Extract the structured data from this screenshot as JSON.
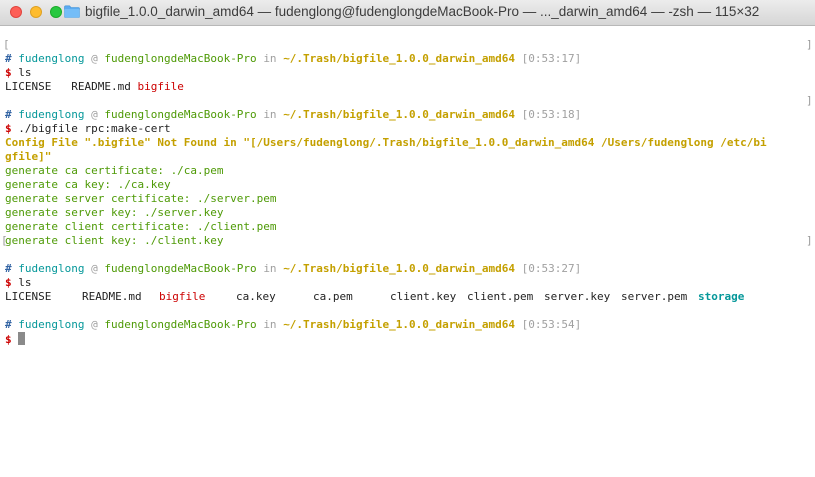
{
  "window": {
    "title": "bigfile_1.0.0_darwin_amd64 — fudenglong@fudenglongdeMacBook-Pro — ..._darwin_amd64 — -zsh — 115×32"
  },
  "prompt": {
    "hash": "#",
    "user": "fudenglong",
    "at": "@",
    "host": "fudenglongdeMacBook-Pro",
    "in": "in",
    "path": "~/.Trash/bigfile_1.0.0_darwin_amd64",
    "dollar": "$"
  },
  "blocks": [
    {
      "time": "[0:53:17]",
      "command": "ls",
      "ls": [
        "LICENSE",
        "README.md",
        "bigfile"
      ]
    },
    {
      "time": "[0:53:18]",
      "command": "./bigfile rpc:make-cert",
      "error_line1": "Config File \".bigfile\" Not Found in \"[/Users/fudenglong/.Trash/bigfile_1.0.0_darwin_amd64 /Users/fudenglong /etc/bi",
      "error_line2": "gfile]\"",
      "output": [
        "generate ca certificate: ./ca.pem",
        "generate ca key: ./ca.key",
        "generate server certificate: ./server.pem",
        "generate server key: ./server.key",
        "generate client certificate: ./client.pem",
        "generate client key: ./client.key"
      ]
    },
    {
      "time": "[0:53:27]",
      "command": "ls",
      "ls": [
        "LICENSE",
        "README.md",
        "bigfile",
        "ca.key",
        "ca.pem",
        "client.key",
        "client.pem",
        "server.key",
        "server.pem",
        "storage"
      ]
    },
    {
      "time": "[0:53:54]"
    }
  ],
  "colors": {
    "prompt_hash": "#3465a4",
    "user": "#06989a",
    "host": "#4e9a06",
    "path": "#c4a000",
    "dollar": "#cc0000",
    "executable": "#cc0000",
    "directory": "#06989a"
  }
}
